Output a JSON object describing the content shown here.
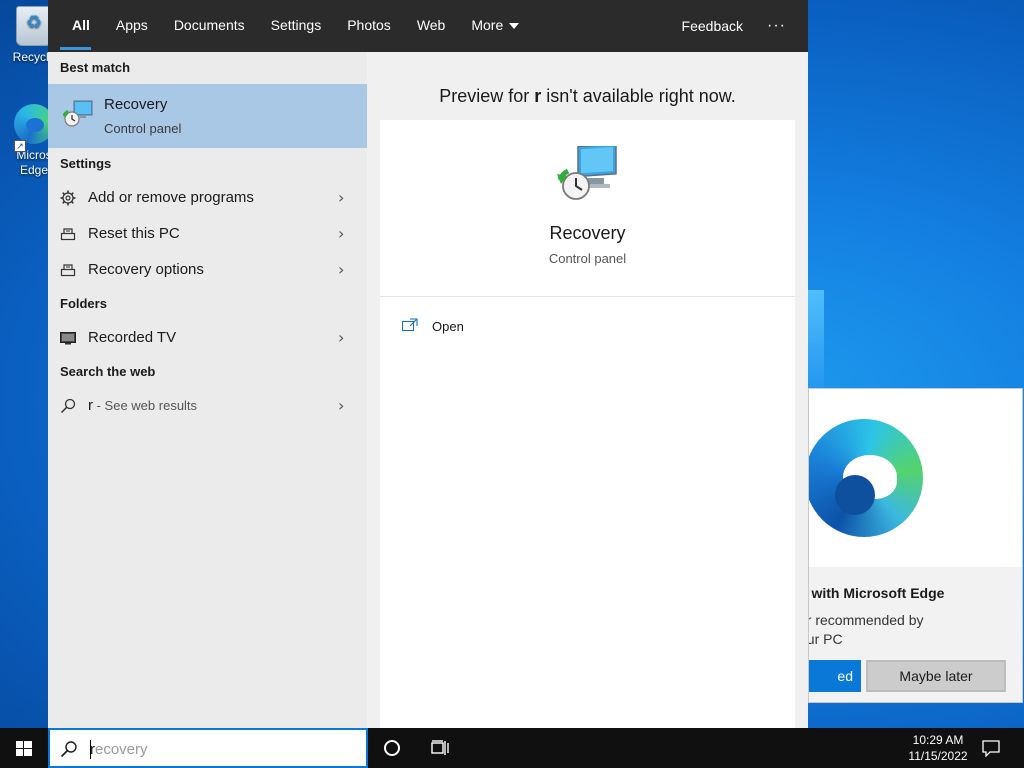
{
  "desktop": {
    "icons": [
      {
        "label": "Recycle"
      },
      {
        "label": "Micros\nEdge"
      }
    ]
  },
  "edge_promo": {
    "title": "b with Microsoft Edge",
    "text_line1": "er recommended by",
    "text_line2": "our PC",
    "primary_button": "ed",
    "secondary_button": "Maybe later"
  },
  "search": {
    "tabs": [
      {
        "label": "All",
        "active": true
      },
      {
        "label": "Apps"
      },
      {
        "label": "Documents"
      },
      {
        "label": "Settings"
      },
      {
        "label": "Photos"
      },
      {
        "label": "Web"
      },
      {
        "label": "More"
      }
    ],
    "feedback_label": "Feedback",
    "more_options": "···",
    "best_match_header": "Best match",
    "best_match": {
      "title": "Recovery",
      "subtitle": "Control panel"
    },
    "settings_header": "Settings",
    "settings_items": [
      {
        "label": "Add or remove programs",
        "icon": "gear-icon"
      },
      {
        "label": "Reset this PC",
        "icon": "reset-pc-icon"
      },
      {
        "label": "Recovery options",
        "icon": "recovery-options-icon"
      }
    ],
    "folders_header": "Folders",
    "folder_items": [
      {
        "label": "Recorded TV",
        "icon": "monitor-icon"
      }
    ],
    "web_header": "Search the web",
    "web_item": {
      "query": "r",
      "suffix": " - See web results"
    },
    "preview": {
      "message_prefix": "Preview for ",
      "message_query": "r",
      "message_suffix": " isn't available right now.",
      "title": "Recovery",
      "subtitle": "Control panel",
      "open_label": "Open"
    }
  },
  "taskbar": {
    "search_typed": "r",
    "search_hint": "ecovery",
    "time": "10:29 AM",
    "date": "11/15/2022"
  },
  "colors": {
    "accent": "#0a78d7",
    "best_match_bg": "#a9c8e6",
    "tab_bar_bg": "#2b2b2b",
    "taskbar_bg": "#101010"
  }
}
